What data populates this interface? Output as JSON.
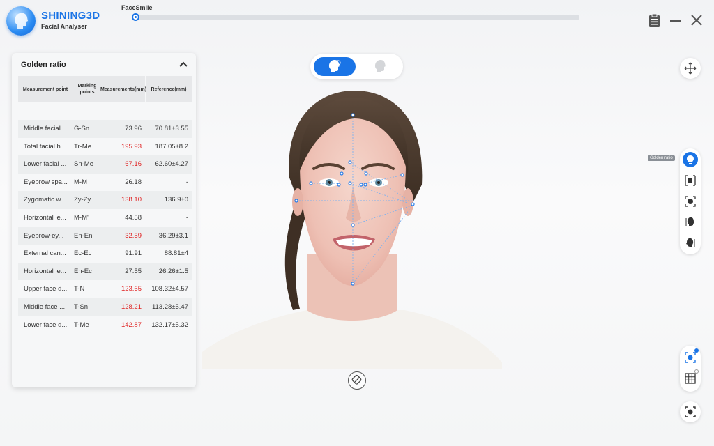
{
  "app": {
    "brand": "SHINING3D",
    "subtitle": "Facial Analyser"
  },
  "progress": {
    "label": "FaceSmile",
    "value": 0.0
  },
  "window": {
    "icons": [
      "clipboard-icon",
      "minimize-icon",
      "close-icon"
    ]
  },
  "panel": {
    "title": "Golden ratio",
    "columns": [
      "Measurement point",
      "Marking points",
      "Measurements(mm)",
      "Reference(mm)"
    ],
    "rows": [
      {
        "point": "Middle facial...",
        "marks": "G-Sn",
        "value": "73.96",
        "ref": "70.81±3.55",
        "alert": false
      },
      {
        "point": "Total facial h...",
        "marks": "Tr-Me",
        "value": "195.93",
        "ref": "187.05±8.2",
        "alert": true
      },
      {
        "point": "Lower facial ...",
        "marks": "Sn-Me",
        "value": "67.16",
        "ref": "62.60±4.27",
        "alert": true
      },
      {
        "point": "Eyebrow spa...",
        "marks": "M-M",
        "value": "26.18",
        "ref": "-",
        "alert": false
      },
      {
        "point": "Zygomatic w...",
        "marks": "Zy-Zy",
        "value": "138.10",
        "ref": "136.9±0",
        "alert": true
      },
      {
        "point": "Horizontal le...",
        "marks": "M-M'",
        "value": "44.58",
        "ref": "-",
        "alert": false
      },
      {
        "point": "Eyebrow-ey...",
        "marks": "En-En",
        "value": "32.59",
        "ref": "36.29±3.1",
        "alert": true
      },
      {
        "point": "External can...",
        "marks": "Ec-Ec",
        "value": "91.91",
        "ref": "88.81±4",
        "alert": false
      },
      {
        "point": "Horizontal le...",
        "marks": "En-Ec",
        "value": "27.55",
        "ref": "26.26±1.5",
        "alert": false
      },
      {
        "point": "Upper face d...",
        "marks": "T-N",
        "value": "123.65",
        "ref": "108.32±4.57",
        "alert": true
      },
      {
        "point": "Middle face ...",
        "marks": "T-Sn",
        "value": "128.21",
        "ref": "113.28±5.47",
        "alert": true
      },
      {
        "point": "Lower face d...",
        "marks": "T-Me",
        "value": "142.87",
        "ref": "132.17±5.32",
        "alert": true
      }
    ]
  },
  "tools": {
    "active_tooltip": "Golden ratio"
  },
  "colors": {
    "accent": "#1a74e6",
    "alert": "#e02020"
  }
}
